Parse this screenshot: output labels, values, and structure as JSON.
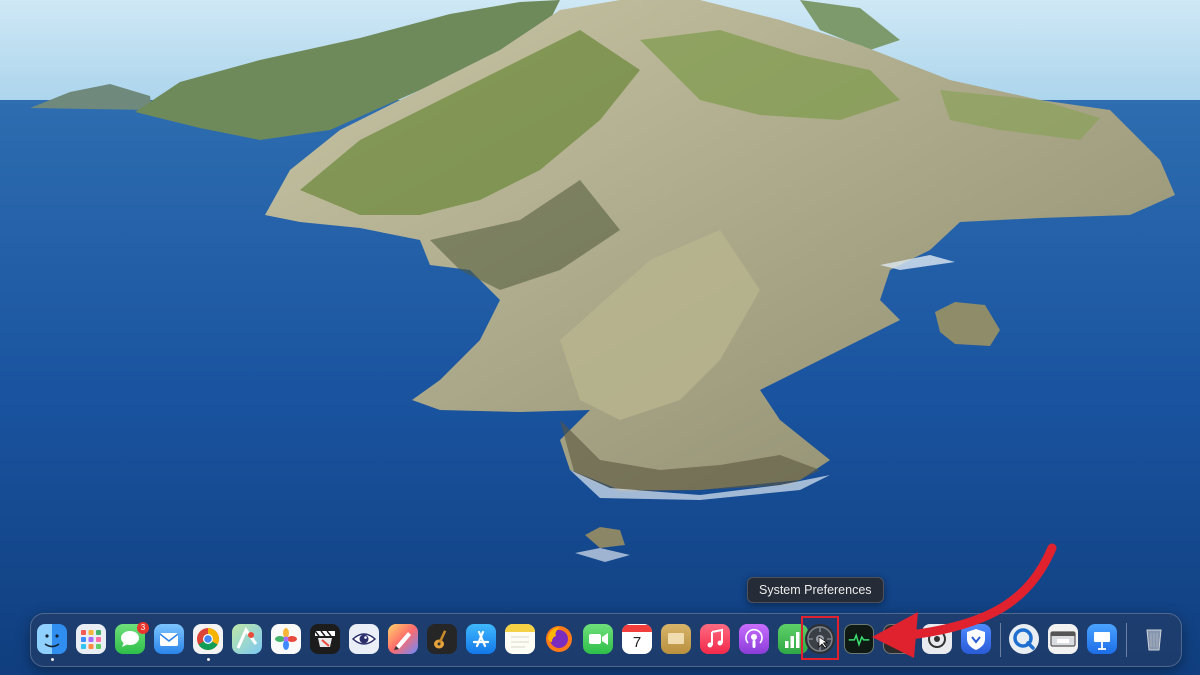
{
  "tooltip": {
    "label": "System Preferences"
  },
  "annotation": {
    "highlight_color": "#e0222e",
    "arrow_color": "#e0222e"
  },
  "dock": {
    "items": [
      {
        "name": "finder-icon",
        "running": true
      },
      {
        "name": "launchpad-icon",
        "running": false
      },
      {
        "name": "messages-icon",
        "running": false,
        "badge": "3"
      },
      {
        "name": "mail-icon",
        "running": false
      },
      {
        "name": "chrome-icon",
        "running": true
      },
      {
        "name": "maps-icon",
        "running": false
      },
      {
        "name": "photos-icon",
        "running": false
      },
      {
        "name": "final-cut-icon",
        "running": false
      },
      {
        "name": "preview-eye-icon",
        "running": false
      },
      {
        "name": "pixelmator-icon",
        "running": false
      },
      {
        "name": "garageband-icon",
        "running": false
      },
      {
        "name": "app-store-icon",
        "running": false
      },
      {
        "name": "notes-icon",
        "running": false
      },
      {
        "name": "firefox-icon",
        "running": false
      },
      {
        "name": "facetime-icon",
        "running": false
      },
      {
        "name": "calendar-icon",
        "running": false,
        "text": "7"
      },
      {
        "name": "keynote-gold-icon",
        "running": false
      },
      {
        "name": "music-icon",
        "running": false
      },
      {
        "name": "podcasts-icon",
        "running": false
      },
      {
        "name": "numbers-icon",
        "running": false
      },
      {
        "name": "system-preferences-icon",
        "running": false
      },
      {
        "name": "activity-monitor-icon",
        "running": false
      },
      {
        "name": "terminal-icon",
        "running": false
      },
      {
        "name": "ai-app-icon",
        "running": false
      },
      {
        "name": "vpn-shield-icon",
        "running": false
      },
      {
        "name": "quicktime-icon",
        "running": false
      },
      {
        "name": "screenshot-icon",
        "running": false
      },
      {
        "name": "keynote-icon",
        "running": false
      },
      {
        "name": "trash-icon",
        "running": false
      }
    ]
  }
}
